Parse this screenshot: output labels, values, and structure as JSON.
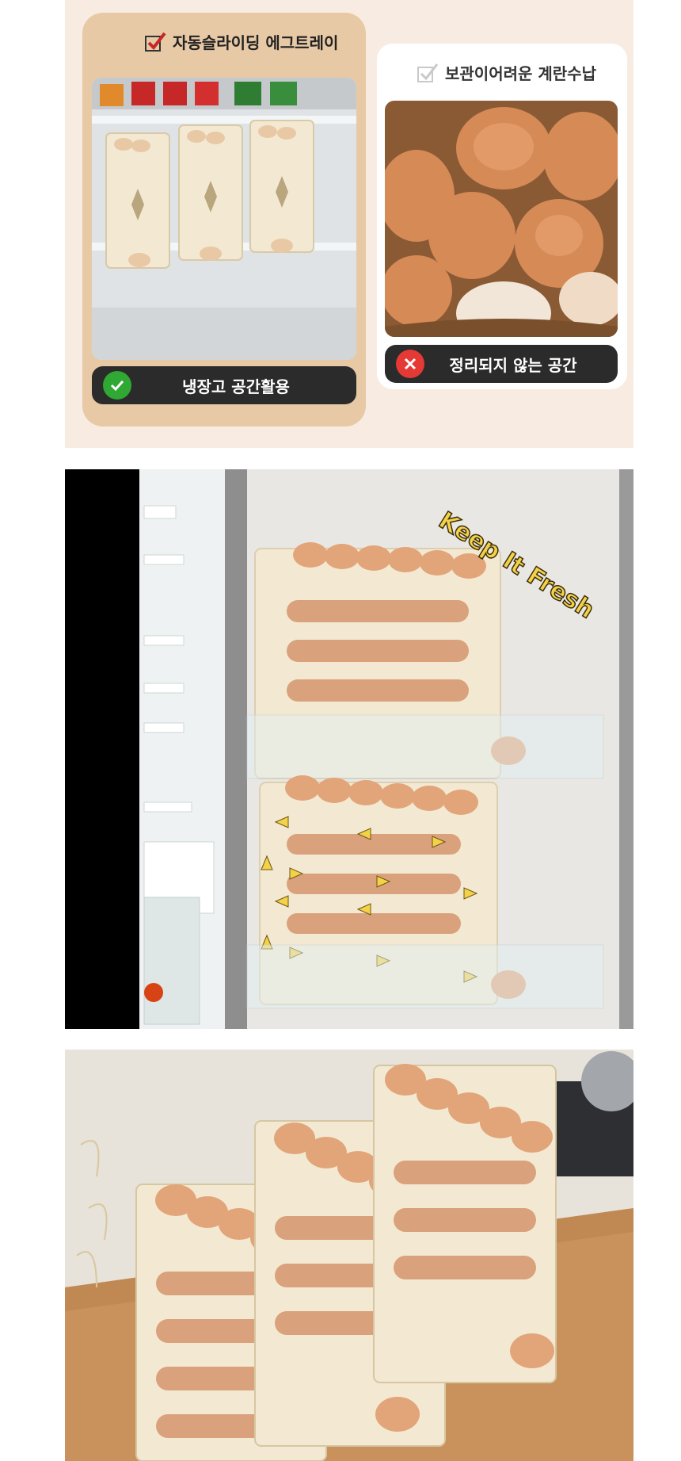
{
  "panel1": {
    "left_card": {
      "caption": "자동슬라이딩 에그트레이",
      "badge_text": "냉장고 공간활용",
      "badge_icon": "check-circle-icon",
      "accent": "#2fa834"
    },
    "right_card": {
      "caption": "보관이어려운 계란수납",
      "badge_text": "정리되지 않는 공간",
      "badge_icon": "x-circle-icon",
      "accent": "#e53935"
    }
  },
  "panel2": {
    "overlay_text": "Keep It Fresh",
    "overlay_color": "#f3d24a"
  },
  "colors": {
    "egg": "#e2a57a",
    "tray": "#f3e9d2",
    "background_warm": "#f8ece2"
  }
}
